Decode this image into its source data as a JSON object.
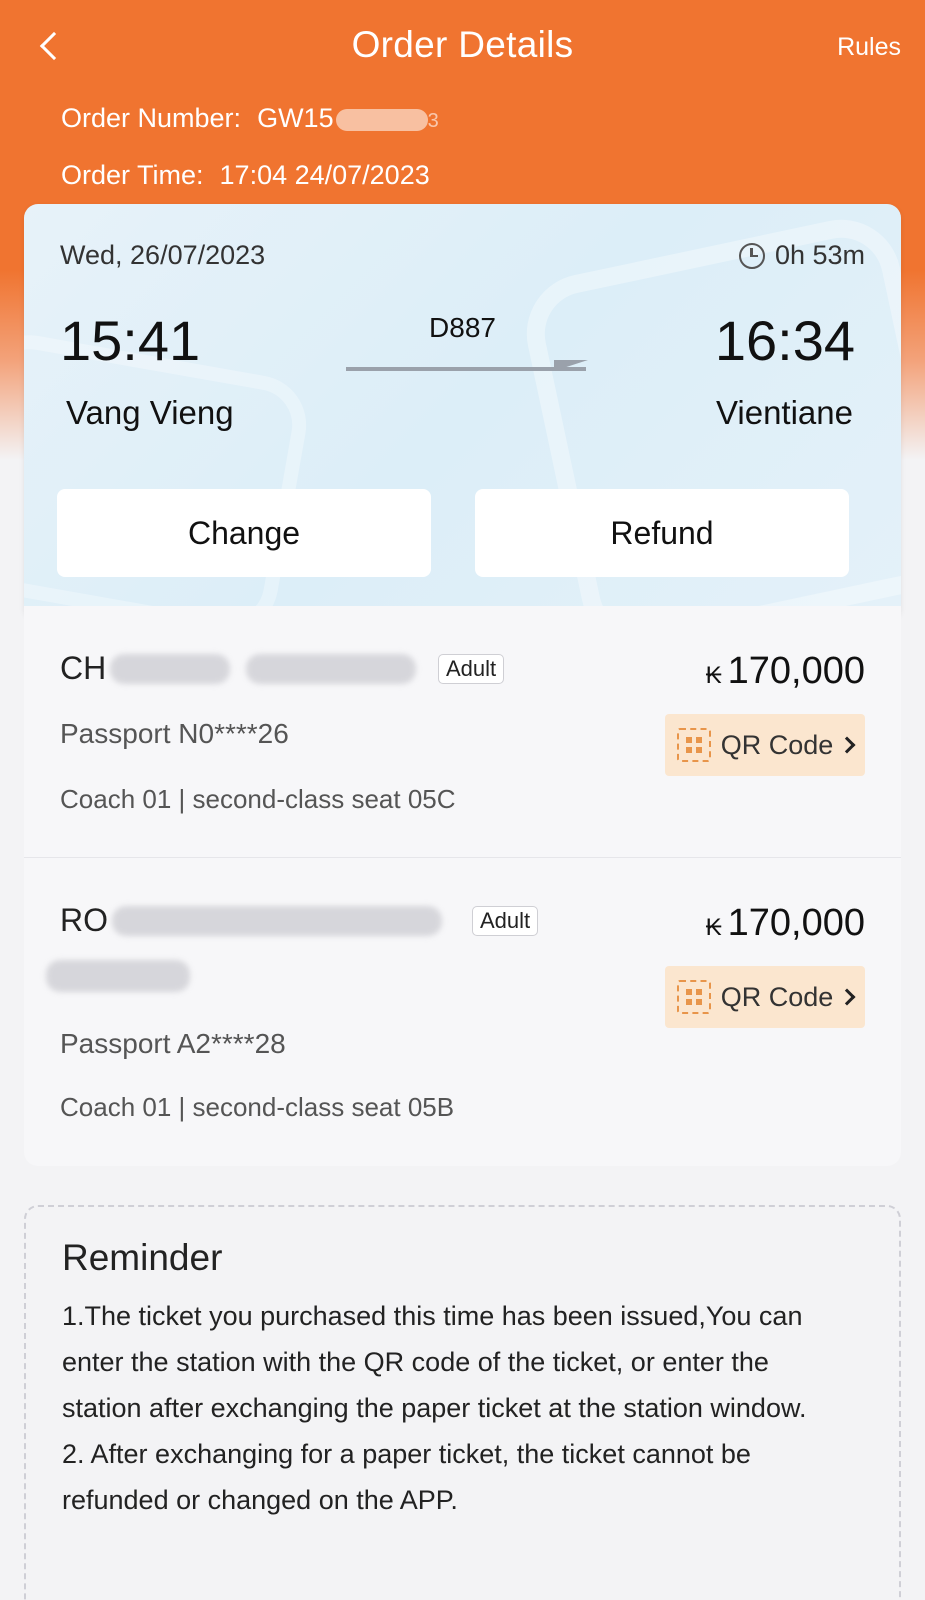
{
  "header": {
    "title": "Order Details",
    "rules_label": "Rules",
    "order_number_label": "Order Number:",
    "order_number_value": "GW15",
    "order_number_tail": "3",
    "order_time_label": "Order Time:",
    "order_time_value": "17:04 24/07/2023"
  },
  "trip": {
    "date": "Wed, 26/07/2023",
    "duration": "0h 53m",
    "train_no": "D887",
    "departure_time": "15:41",
    "arrival_time": "16:34",
    "departure_station": "Vang Vieng",
    "arrival_station": "Vientiane",
    "change_label": "Change",
    "refund_label": "Refund"
  },
  "passengers": [
    {
      "name_visible": "CH",
      "type": "Adult",
      "currency_symbol": "₭",
      "price": "170,000",
      "passport": "Passport  N0****26",
      "seat": "Coach 01 | second-class seat 05C",
      "qr_label": "QR Code"
    },
    {
      "name_visible": "RO",
      "type": "Adult",
      "currency_symbol": "₭",
      "price": "170,000",
      "passport": "Passport  A2****28",
      "seat": "Coach 01 | second-class seat 05B",
      "qr_label": "QR Code"
    }
  ],
  "reminder": {
    "title": "Reminder",
    "items": [
      "1.The ticket you purchased this time has been issued,You can enter the station with the QR code of the ticket, or enter the station after exchanging the paper ticket at the station window.",
      "2. After exchanging for a paper ticket, the ticket cannot be refunded or changed on the APP."
    ]
  },
  "colors": {
    "brand_orange": "#f07430",
    "qr_button_bg": "#fbe6cf",
    "qr_icon": "#e8954a"
  }
}
